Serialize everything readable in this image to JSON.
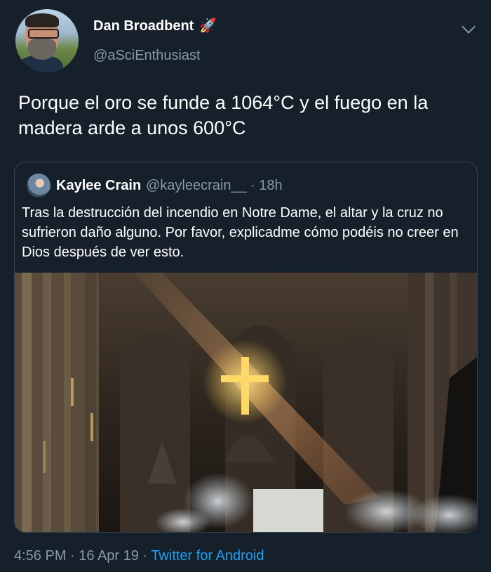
{
  "author": {
    "name": "Dan Broadbent",
    "name_emoji": "🚀",
    "handle": "@aSciEnthusiast"
  },
  "tweet": {
    "text": "Porque el oro se funde a 1064°C y el fuego en la madera arde a unos 600°C"
  },
  "quoted": {
    "name": "Kaylee Crain",
    "handle": "@kayleecrain__",
    "time": "· 18h",
    "text": "Tras la destrucción del incendio en Notre Dame, el altar y la cruz no sufrieron daño alguno. Por favor, explicadme cómo podéis no creer en Dios después de ver esto."
  },
  "footer": {
    "time": "4:56 PM",
    "sep1": " · ",
    "date": "16 Apr 19",
    "sep2": " · ",
    "source": "Twitter for Android"
  },
  "colors": {
    "background": "#15202b",
    "secondary_text": "#8899a6",
    "link": "#1da1f2",
    "border": "#38444d"
  },
  "icons": {
    "name_badge": "rocket-emoji",
    "menu": "chevron-down-icon"
  }
}
